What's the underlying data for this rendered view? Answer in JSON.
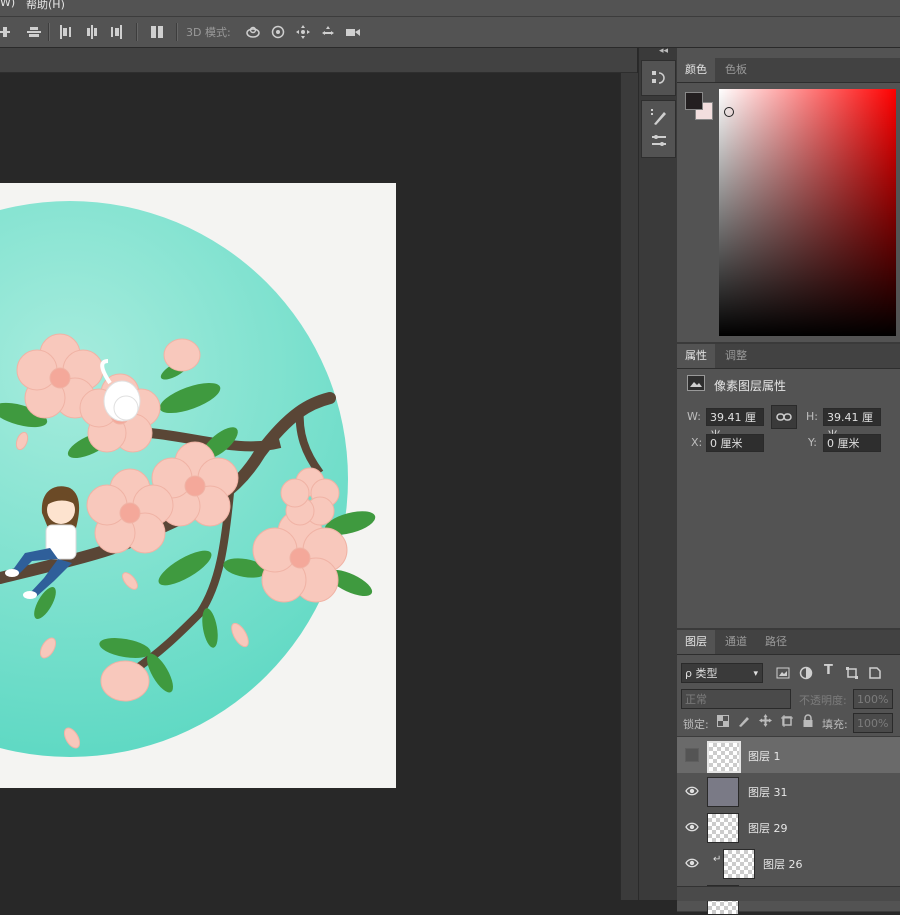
{
  "menu": {
    "item1": "W)",
    "item2": "帮助(H)"
  },
  "options_bar": {
    "mode3d_label": "3D 模式:"
  },
  "panel_collapse": {
    "label": "◂◂"
  },
  "color_panel": {
    "tabs": [
      "颜色",
      "色板"
    ],
    "foreground_color": "#231f20",
    "background_color": "#f2dede",
    "hue_color": "#ff0000"
  },
  "properties_panel": {
    "tabs": [
      "属性",
      "调整"
    ],
    "title": "像素图层属性",
    "w_label": "W:",
    "w_value": "39.41 厘米",
    "h_label": "H:",
    "h_value": "39.41 厘米",
    "x_label": "X:",
    "x_value": "0 厘米",
    "y_label": "Y:",
    "y_value": "0 厘米"
  },
  "layers_panel": {
    "tabs": [
      "图层",
      "通道",
      "路径"
    ],
    "filter_label": "ρ 类型",
    "blend_mode": "正常",
    "opacity_label": "不透明度:",
    "opacity_value": "100%",
    "lock_label": "锁定:",
    "fill_label": "填充:",
    "fill_value": "100%",
    "layers": [
      {
        "name": "图层 1",
        "visible": false,
        "selected": true
      },
      {
        "name": "图层 31",
        "visible": true,
        "selected": false
      },
      {
        "name": "图层 29",
        "visible": true,
        "selected": false
      },
      {
        "name": "图层 26",
        "visible": true,
        "selected": false,
        "clipped": true
      }
    ]
  },
  "colors": {
    "app_bg": "#282828",
    "panel_bg": "#535353",
    "artwork_circle": "#6fdcc8",
    "blossom": "#f8c8bc",
    "leaf": "#3f9a3f",
    "branch": "#5a4636"
  }
}
